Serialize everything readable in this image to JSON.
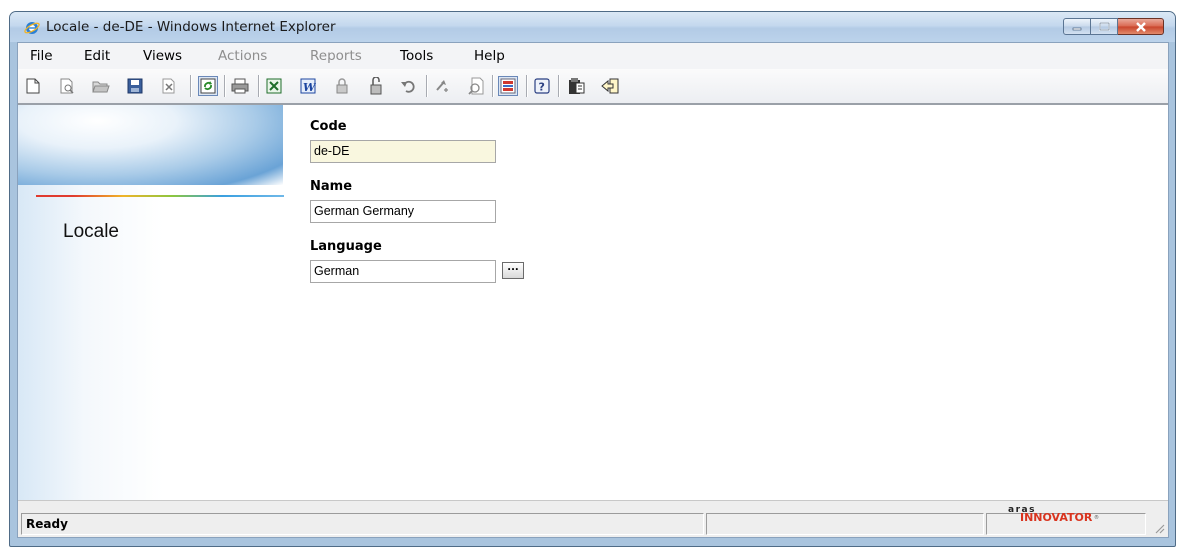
{
  "window": {
    "title": "Locale - de-DE - Windows Internet Explorer"
  },
  "menu": [
    {
      "label": "File",
      "enabled": true
    },
    {
      "label": "Edit",
      "enabled": true
    },
    {
      "label": "Views",
      "enabled": true
    },
    {
      "label": "Actions",
      "enabled": false
    },
    {
      "label": "Reports",
      "enabled": false
    },
    {
      "label": "Tools",
      "enabled": true
    },
    {
      "label": "Help",
      "enabled": true
    }
  ],
  "toolbar_icons": [
    "new-document-icon",
    "print-preview-icon",
    "open-folder-icon",
    "save-icon",
    "close-document-icon",
    "refresh-icon",
    "print-icon",
    "excel-icon",
    "word-icon",
    "lock-icon",
    "unlock-icon",
    "undo-icon",
    "promote-icon",
    "where-used-icon",
    "structure-browser-icon",
    "help-icon",
    "clipboard-icon",
    "exit-icon"
  ],
  "banner": {
    "label": "Locale"
  },
  "form": {
    "code": {
      "label": "Code",
      "value": "de-DE"
    },
    "name": {
      "label": "Name",
      "value": "German Germany"
    },
    "language": {
      "label": "Language",
      "value": "German",
      "picker_label": "..."
    }
  },
  "status": {
    "text": "Ready",
    "logo_text_top": "aras",
    "logo_text_main": "INNOVATOR"
  },
  "colors": {
    "title_bar": "#c4d8ee",
    "code_field_background": "#f9f7df",
    "logo_red": "#d9341f"
  }
}
